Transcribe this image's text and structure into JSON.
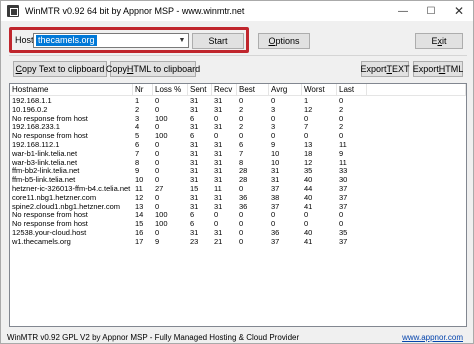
{
  "window": {
    "title": "WinMTR v0.92 64 bit by Appnor MSP - www.winmtr.net",
    "minimize": "—",
    "maximize": "☐",
    "close": "✕"
  },
  "host": {
    "label": "Host:",
    "value": "thecamels.org"
  },
  "buttons": {
    "start": "Start",
    "options_pre": "",
    "options_u": "O",
    "options_post": "ptions",
    "exit_pre": "E",
    "exit_u": "x",
    "exit_post": "it",
    "copy_text_pre": "",
    "copy_text_u": "C",
    "copy_text_post": "opy Text to clipboard",
    "copy_html_pre": "Copy ",
    "copy_html_u": "H",
    "copy_html_post": "TML to clipboard",
    "export_text_pre": "Export ",
    "export_text_u": "T",
    "export_text_post": "EXT",
    "export_html_pre": "Export ",
    "export_html_u": "H",
    "export_html_post": "TML"
  },
  "table": {
    "columns": [
      "Hostname",
      "Nr",
      "Loss %",
      "Sent",
      "Recv",
      "Best",
      "Avrg",
      "Worst",
      "Last"
    ],
    "rows": [
      [
        "192.168.1.1",
        "1",
        "0",
        "31",
        "31",
        "0",
        "0",
        "1",
        "0"
      ],
      [
        "10.196.0.2",
        "2",
        "0",
        "31",
        "31",
        "2",
        "3",
        "12",
        "2"
      ],
      [
        "No response from host",
        "3",
        "100",
        "6",
        "0",
        "0",
        "0",
        "0",
        "0"
      ],
      [
        "192.168.233.1",
        "4",
        "0",
        "31",
        "31",
        "2",
        "3",
        "7",
        "2"
      ],
      [
        "No response from host",
        "5",
        "100",
        "6",
        "0",
        "0",
        "0",
        "0",
        "0"
      ],
      [
        "192.168.112.1",
        "6",
        "0",
        "31",
        "31",
        "6",
        "9",
        "13",
        "11"
      ],
      [
        "war-b1-link.telia.net",
        "7",
        "0",
        "31",
        "31",
        "7",
        "10",
        "18",
        "9"
      ],
      [
        "war-b3-link.telia.net",
        "8",
        "0",
        "31",
        "31",
        "8",
        "10",
        "12",
        "11"
      ],
      [
        "ffm-bb2-link.telia.net",
        "9",
        "0",
        "31",
        "31",
        "28",
        "31",
        "35",
        "33"
      ],
      [
        "ffm-b5-link.telia.net",
        "10",
        "0",
        "31",
        "31",
        "28",
        "31",
        "40",
        "30"
      ],
      [
        "hetzner-ic-326013-ffm-b4.c.telia.net",
        "11",
        "27",
        "15",
        "11",
        "0",
        "37",
        "44",
        "37"
      ],
      [
        "core11.nbg1.hetzner.com",
        "12",
        "0",
        "31",
        "31",
        "36",
        "38",
        "40",
        "37"
      ],
      [
        "spine2.cloud1.nbg1.hetzner.com",
        "13",
        "0",
        "31",
        "31",
        "36",
        "37",
        "41",
        "37"
      ],
      [
        "No response from host",
        "14",
        "100",
        "6",
        "0",
        "0",
        "0",
        "0",
        "0"
      ],
      [
        "No response from host",
        "15",
        "100",
        "6",
        "0",
        "0",
        "0",
        "0",
        "0"
      ],
      [
        "12538.your-cloud.host",
        "16",
        "0",
        "31",
        "31",
        "0",
        "36",
        "40",
        "35"
      ],
      [
        "w1.thecamels.org",
        "17",
        "9",
        "23",
        "21",
        "0",
        "37",
        "41",
        "37"
      ]
    ]
  },
  "status": {
    "text": "WinMTR v0.92 GPL V2 by Appnor MSP - Fully Managed Hosting & Cloud Provider",
    "link": "www.appnor.com"
  }
}
